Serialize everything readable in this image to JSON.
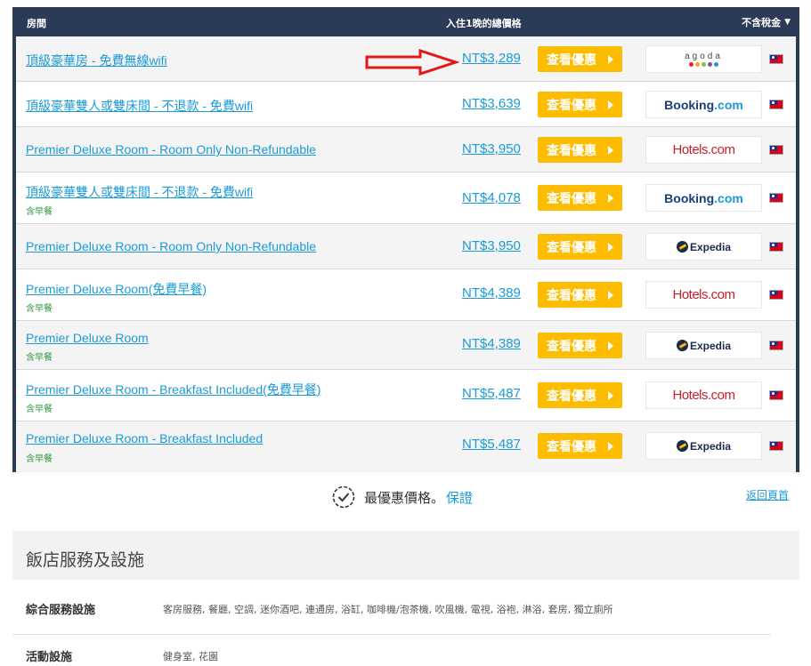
{
  "table": {
    "header": {
      "room": "房間",
      "price": "入住1晚的總價格",
      "tax": "不含稅金"
    },
    "deal_label": "查看優惠",
    "rows": [
      {
        "room": "頂級豪華房 - 免費無線wifi",
        "breakfast": "",
        "price": "NT$3,289",
        "provider": "agoda"
      },
      {
        "room": "頂級豪華雙人或雙床間 - 不退款 - 免費wifi",
        "breakfast": "",
        "price": "NT$3,639",
        "provider": "Booking.com"
      },
      {
        "room": "Premier Deluxe Room - Room Only Non-Refundable",
        "breakfast": "",
        "price": "NT$3,950",
        "provider": "Hotels.com"
      },
      {
        "room": "頂級豪華雙人或雙床間 - 不退款 - 免費wifi",
        "breakfast": "含早餐",
        "price": "NT$4,078",
        "provider": "Booking.com"
      },
      {
        "room": "Premier Deluxe Room - Room Only Non-Refundable",
        "breakfast": "",
        "price": "NT$3,950",
        "provider": "Expedia"
      },
      {
        "room": "Premier Deluxe Room(免費早餐)",
        "breakfast": "含早餐",
        "price": "NT$4,389",
        "provider": "Hotels.com"
      },
      {
        "room": "Premier Deluxe Room",
        "breakfast": "含早餐",
        "price": "NT$4,389",
        "provider": "Expedia"
      },
      {
        "room": "Premier Deluxe Room - Breakfast Included(免費早餐)",
        "breakfast": "含早餐",
        "price": "NT$5,487",
        "provider": "Hotels.com"
      },
      {
        "room": "Premier Deluxe Room - Breakfast Included",
        "breakfast": "含早餐",
        "price": "NT$5,487",
        "provider": "Expedia"
      }
    ]
  },
  "logos": {
    "agoda": "agoda",
    "booking_main": "Booking",
    "booking_dot": ".com",
    "hotels": "Hotels.com",
    "expedia": "Expedia"
  },
  "colors": {
    "header_bg": "#2b3a57",
    "link": "#1a9bd7",
    "deal_button": "#fcbc00",
    "breakfast": "#2e9a3f",
    "arrow": "#e01818"
  },
  "guarantee": {
    "text": "最優惠價格。",
    "link": "保證"
  },
  "back_to_top": "返回頁首",
  "facilities": {
    "title": "飯店服務及設施",
    "items": [
      {
        "label": "綜合服務設施",
        "value": "客房服務, 餐廳, 空調, 迷你酒吧, 連通房, 浴缸, 咖啡機/泡茶機, 吹風機, 電視, 浴袍, 淋浴, 套房, 獨立廁所"
      },
      {
        "label": "活動設施",
        "value": "健身室, 花園"
      }
    ]
  }
}
